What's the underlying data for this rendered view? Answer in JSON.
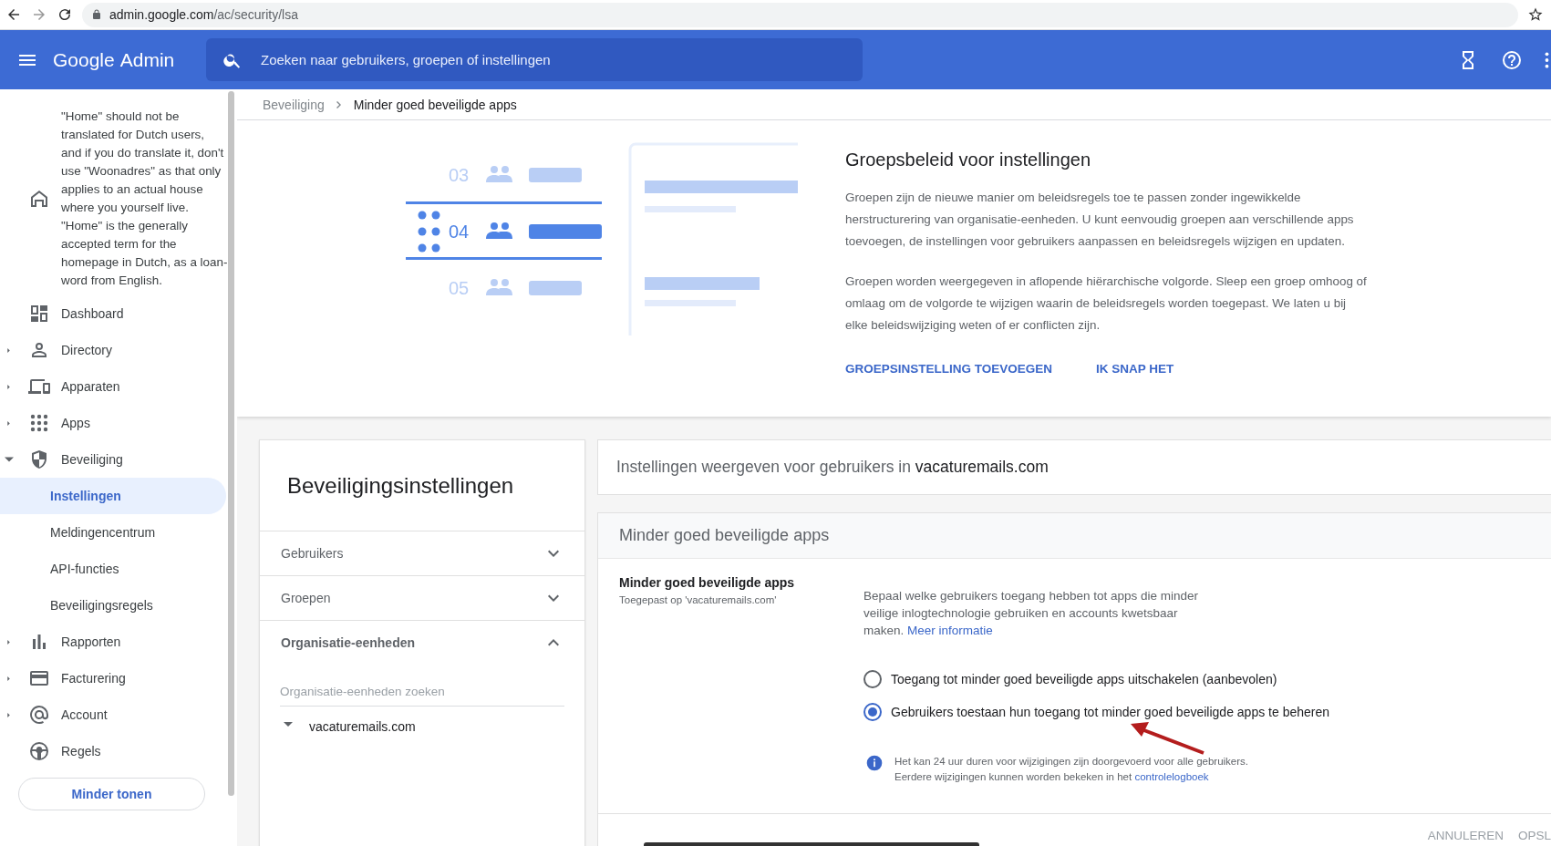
{
  "browser": {
    "url_host": "admin.google.com",
    "url_path": "/ac/security/lsa"
  },
  "app_bar": {
    "title_google": "Google",
    "title_admin": "Admin",
    "search": {
      "placeholder": "Zoeken naar gebruikers, groepen of instellingen"
    }
  },
  "sidebar": {
    "items": [
      {
        "label": "\"Home\" should not be translated for Dutch users, and if you do translate it, don't use \"Woonadres\" as that only applies to an actual house where you yourself live. \"Home\" is the generally accepted term for the homepage in Dutch, as a loan-word from English.",
        "kind": "link"
      },
      {
        "label": "Dashboard",
        "kind": "link"
      },
      {
        "label": "Directory",
        "kind": "group",
        "expanded": false
      },
      {
        "label": "Apparaten",
        "kind": "group",
        "expanded": false
      },
      {
        "label": "Apps",
        "kind": "group",
        "expanded": false
      },
      {
        "label": "Beveiliging",
        "kind": "group",
        "expanded": true,
        "children": [
          {
            "label": "Instellingen",
            "selected": true
          },
          {
            "label": "Meldingencentrum",
            "selected": false
          },
          {
            "label": "API-functies",
            "selected": false
          },
          {
            "label": "Beveiligingsregels",
            "selected": false
          }
        ]
      },
      {
        "label": "Rapporten",
        "kind": "group",
        "expanded": false
      },
      {
        "label": "Facturering",
        "kind": "group",
        "expanded": false
      },
      {
        "label": "Account",
        "kind": "group",
        "expanded": false
      },
      {
        "label": "Regels",
        "kind": "link"
      }
    ],
    "more_button": "Minder tonen"
  },
  "breadcrumb": [
    "Beveiliging",
    "Minder goed beveiligde apps"
  ],
  "banner": {
    "illustration": {
      "rows": [
        {
          "number": "03",
          "selected": false
        },
        {
          "number": "04",
          "selected": true
        },
        {
          "number": "05",
          "selected": false
        }
      ]
    },
    "title": "Groepsbeleid voor instellingen",
    "paragraphs": [
      "Groepen zijn de nieuwe manier om beleidsregels toe te passen zonder ingewikkelde herstructurering van organisatie-eenheden. U kunt eenvoudig groepen aan verschillende apps toevoegen, de instellingen voor gebruikers aanpassen en beleidsregels wijzigen en updaten.",
      "Groepen worden weergegeven in aflopende hiërarchische volgorde. Sleep een groep omhoog of omlaag om de volgorde te wijzigen waarin de beleidsregels worden toegepast. We laten u bij elke beleidswijziging weten of er conflicten zijn."
    ],
    "actions": [
      "GROEPSINSTELLING TOEVOEGEN",
      "IK SNAP HET"
    ]
  },
  "left_panel": {
    "title": "Beveiligingsinstellingen",
    "sections": [
      {
        "label": "Gebruikers",
        "expanded": false
      },
      {
        "label": "Groepen",
        "expanded": false
      },
      {
        "label": "Organisatie-eenheden",
        "expanded": true,
        "search": {
          "placeholder": "Organisatie-eenheden zoeken"
        },
        "tree": [
          {
            "label": "vacaturemails.com",
            "expanded": true
          }
        ]
      }
    ]
  },
  "org_header": {
    "text": "Instellingen weergeven voor gebruikers in **vacaturemails.com**"
  },
  "settings": {
    "section_title": "Minder goed beveiligde apps",
    "setting": {
      "title": "Minder goed beveiligde apps",
      "subtitle": "Toegepast op 'vacaturemails.com'",
      "description": "Bepaal welke gebruikers toegang hebben tot apps die minder veilige inlogtechnologie gebruiken en accounts kwetsbaar maken.",
      "description_link": "Meer informatie",
      "options": [
        {
          "label": "Toegang tot minder goed beveiligde apps uitschakelen (aanbevolen)",
          "selected": false
        },
        {
          "label": "Gebruikers toestaan hun toegang tot minder goed beveiligde apps te beheren",
          "selected": true
        }
      ],
      "note_lines": [
        "Het kan 24 uur duren voor wijzigingen zijn doorgevoerd voor alle gebruikers.",
        "Eerdere wijzigingen kunnen worden bekeken in het"
      ],
      "note_link": "controlelogboek"
    },
    "actions": [
      "ANNULEREN",
      "OPSL"
    ]
  }
}
